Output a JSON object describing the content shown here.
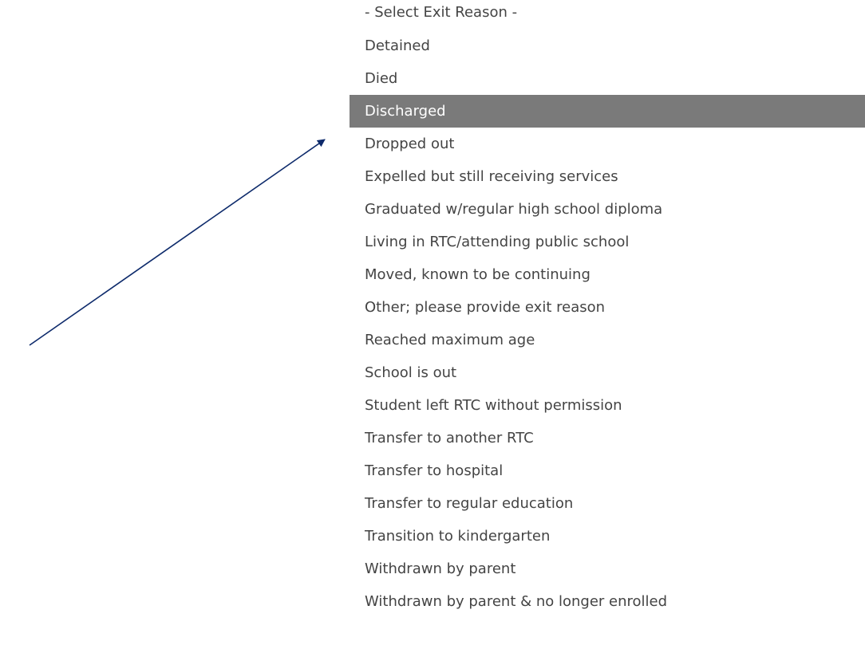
{
  "dropdown": {
    "selected_index": 3,
    "options": [
      "- Select Exit Reason -",
      "Detained",
      "Died",
      "Discharged",
      "Dropped out",
      "Expelled but still receiving services",
      "Graduated w/regular high school diploma",
      "Living in RTC/attending public school",
      "Moved, known to be continuing",
      "Other; please provide exit reason",
      "Reached maximum age",
      "School is out",
      "Student left RTC without permission",
      "Transfer to another RTC",
      "Transfer to hospital",
      "Transfer to regular education",
      "Transition to kindergarten",
      "Withdrawn by parent",
      "Withdrawn by parent & no longer enrolled"
    ]
  },
  "annotation": {
    "arrow_color": "#0d2a6b",
    "highlight_color": "#7a7a7a"
  }
}
